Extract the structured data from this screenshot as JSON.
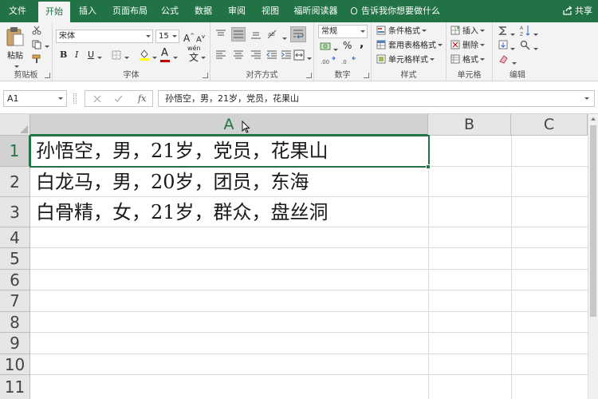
{
  "tabs": {
    "file": "文件",
    "home": "开始",
    "insert": "插入",
    "layout": "页面布局",
    "formula": "公式",
    "data": "数据",
    "review": "审阅",
    "view": "视图",
    "foxit": "福昕阅读器",
    "tellme": "告诉我你想要做什么",
    "share": "共享"
  },
  "ribbon": {
    "clipboard": {
      "label": "剪贴板",
      "paste": "粘贴"
    },
    "font": {
      "label": "字体",
      "font_name": "宋体",
      "font_size": "15",
      "bold": "B",
      "italic": "I",
      "underline": "U",
      "grow": "A",
      "shrink": "A",
      "font_color": "A",
      "phonetic": "wén"
    },
    "alignment": {
      "label": "对齐方式"
    },
    "number": {
      "label": "数字",
      "format": "常规",
      "percent": "%",
      "comma": ","
    },
    "styles": {
      "label": "样式",
      "conditional": "条件格式",
      "table": "套用表格格式",
      "cell_styles": "单元格样式"
    },
    "cells": {
      "label": "单元格",
      "insert": "插入",
      "delete": "删除",
      "format": "格式"
    },
    "editing": {
      "label": "编辑"
    }
  },
  "formula_bar": {
    "name_box": "A1",
    "fx": "fx",
    "content": "孙悟空，男，21岁，党员，花果山"
  },
  "grid": {
    "columns": [
      "A",
      "B",
      "C"
    ],
    "rows": [
      "1",
      "2",
      "3",
      "4",
      "5",
      "6",
      "7",
      "8",
      "9",
      "10",
      "11"
    ],
    "cells": [
      "孙悟空，男，21岁，党员，花果山",
      "白龙马，男，20岁，团员，东海",
      "白骨精，女，21岁，群众，盘丝洞"
    ]
  },
  "colors": {
    "brand": "#217346",
    "ribbon_bg": "#f3f3f3",
    "header_bg": "#e6e6e6",
    "gridline": "#dadada"
  },
  "icons": [
    "paste-icon",
    "cut-icon",
    "copy-icon",
    "format-painter-icon",
    "bulb-icon",
    "share-icon",
    "sum-icon",
    "sort-icon",
    "find-icon",
    "fill-icon",
    "clear-icon",
    "cursor-icon"
  ]
}
